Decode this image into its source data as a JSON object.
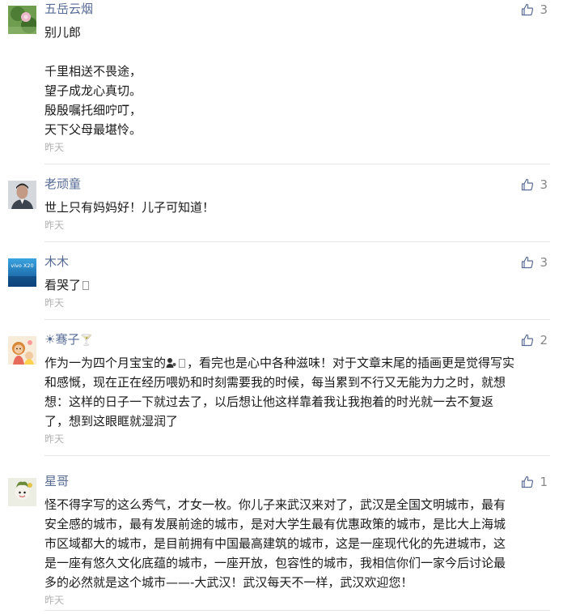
{
  "comments": [
    {
      "nickname": "五岳云烟",
      "likes": "3",
      "lines": [
        "别儿郎",
        "",
        "千里相送不畏途，",
        "望子成龙心真切。",
        "殷殷嘱托细咛叮，",
        "天下父母最堪怜。"
      ],
      "time": "昨天"
    },
    {
      "nickname": "老顽童",
      "likes": "3",
      "lines": [
        "世上只有妈妈好！儿子可知道！"
      ],
      "time": "昨天"
    },
    {
      "nickname": "木木",
      "likes": "3",
      "text": "看哭了",
      "time": "昨天",
      "avatar_text": "vivo X20"
    },
    {
      "nickname_prefix": "☀",
      "nickname": "骞子",
      "nickname_suffix": "🍸",
      "likes": "2",
      "first_line_a": "作为一为四个月宝宝的",
      "first_line_b": "，看完也是心中各种滋味！对于文章末尾的插画更是觉得写实",
      "lines_rest": [
        "和感慨，现在正在经历喂奶和时刻需要我的时候，每当累到不行又无能为力之时，就想",
        "想：这样的日子一下就过去了，以后想让他这样靠着我让我抱着的时光就一去不复返",
        "了，想到这眼眶就湿润了"
      ],
      "time": "昨天"
    },
    {
      "nickname": "星哥",
      "likes": "1",
      "lines": [
        "怪不得字写的这么秀气，才女一枚。你儿子来武汉来对了，武汉是全国文明城市，最有",
        "安全感的城市，最有发展前途的城市，是对大学生最有优惠政策的城市，是比大上海城",
        "市区域都大的城市，是目前拥有中国最高建筑的城市，这是一座现代化的先进城市，这",
        "是一座有悠久文化底蕴的城市，一座开放，包容性的城市，我相信你们一家今后讨论最",
        "多的必然就是这个城市——-大武汉！武汉每天不一样，武汉欢迎您！"
      ],
      "time": "昨天"
    }
  ],
  "icons": {
    "like": "thumbs-up-icon",
    "emoji_mother": "mother-baby-emoji-icon",
    "missing": "missing-glyph-icon"
  },
  "colors": {
    "nickname": "#576b95",
    "like": "#576b95",
    "time": "#b2b2b2",
    "divider": "#e5e5e5"
  }
}
